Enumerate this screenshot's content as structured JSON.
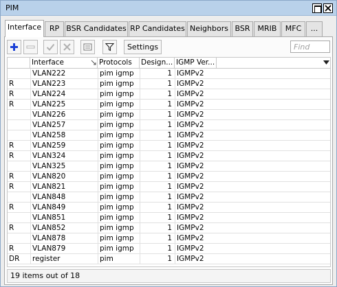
{
  "window": {
    "title": "PIM"
  },
  "tabs": [
    {
      "label": "Interface",
      "active": true
    },
    {
      "label": "RP",
      "active": false
    },
    {
      "label": "BSR Candidates",
      "active": false
    },
    {
      "label": "RP Candidates",
      "active": false
    },
    {
      "label": "Neighbors",
      "active": false
    },
    {
      "label": "BSR",
      "active": false
    },
    {
      "label": "MRIB",
      "active": false
    },
    {
      "label": "MFC",
      "active": false
    },
    {
      "label": "...",
      "active": false
    }
  ],
  "toolbar": {
    "add_icon": "plus-icon",
    "remove_icon": "minus-icon",
    "enable_icon": "check-icon",
    "disable_icon": "x-icon",
    "comment_icon": "comment-icon",
    "filter_icon": "filter-icon",
    "settings_label": "Settings",
    "find_placeholder": "Find"
  },
  "table": {
    "columns": [
      "",
      "Interface",
      "Protocols",
      "Design...",
      "IGMP Ver..."
    ],
    "rows": [
      {
        "flag": "",
        "interface": "VLAN222",
        "protocols": "pim igmp",
        "dr": "1",
        "igmp": "IGMPv2"
      },
      {
        "flag": "R",
        "interface": "VLAN223",
        "protocols": "pim igmp",
        "dr": "1",
        "igmp": "IGMPv2"
      },
      {
        "flag": "R",
        "interface": "VLAN224",
        "protocols": "pim igmp",
        "dr": "1",
        "igmp": "IGMPv2"
      },
      {
        "flag": "R",
        "interface": "VLAN225",
        "protocols": "pim igmp",
        "dr": "1",
        "igmp": "IGMPv2"
      },
      {
        "flag": "",
        "interface": "VLAN226",
        "protocols": "pim igmp",
        "dr": "1",
        "igmp": "IGMPv2"
      },
      {
        "flag": "",
        "interface": "VLAN257",
        "protocols": "pim igmp",
        "dr": "1",
        "igmp": "IGMPv2"
      },
      {
        "flag": "",
        "interface": "VLAN258",
        "protocols": "pim igmp",
        "dr": "1",
        "igmp": "IGMPv2"
      },
      {
        "flag": "R",
        "interface": "VLAN259",
        "protocols": "pim igmp",
        "dr": "1",
        "igmp": "IGMPv2"
      },
      {
        "flag": "R",
        "interface": "VLAN324",
        "protocols": "pim igmp",
        "dr": "1",
        "igmp": "IGMPv2"
      },
      {
        "flag": "",
        "interface": "VLAN325",
        "protocols": "pim igmp",
        "dr": "1",
        "igmp": "IGMPv2"
      },
      {
        "flag": "R",
        "interface": "VLAN820",
        "protocols": "pim igmp",
        "dr": "1",
        "igmp": "IGMPv2"
      },
      {
        "flag": "R",
        "interface": "VLAN821",
        "protocols": "pim igmp",
        "dr": "1",
        "igmp": "IGMPv2"
      },
      {
        "flag": "",
        "interface": "VLAN848",
        "protocols": "pim igmp",
        "dr": "1",
        "igmp": "IGMPv2"
      },
      {
        "flag": "R",
        "interface": "VLAN849",
        "protocols": "pim igmp",
        "dr": "1",
        "igmp": "IGMPv2"
      },
      {
        "flag": "",
        "interface": "VLAN851",
        "protocols": "pim igmp",
        "dr": "1",
        "igmp": "IGMPv2"
      },
      {
        "flag": "R",
        "interface": "VLAN852",
        "protocols": "pim igmp",
        "dr": "1",
        "igmp": "IGMPv2"
      },
      {
        "flag": "",
        "interface": "VLAN878",
        "protocols": "pim igmp",
        "dr": "1",
        "igmp": "IGMPv2"
      },
      {
        "flag": "R",
        "interface": "VLAN879",
        "protocols": "pim igmp",
        "dr": "1",
        "igmp": "IGMPv2"
      },
      {
        "flag": "DR",
        "interface": "register",
        "protocols": "pim",
        "dr": "1",
        "igmp": "IGMPv2"
      }
    ]
  },
  "status": {
    "text": "19 items out of 18"
  },
  "colors": {
    "titlebar": "#b9d1ea",
    "add_icon": "#1a3fd6",
    "disabled_icon": "#b0b0b0"
  }
}
